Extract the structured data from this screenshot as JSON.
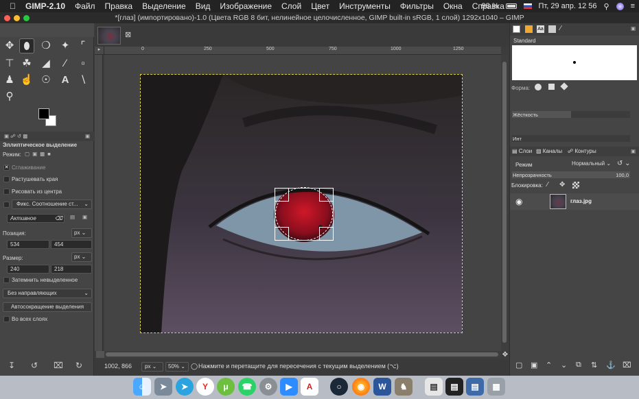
{
  "menubar": {
    "app": "GIMP-2.10",
    "items": [
      "Файл",
      "Правка",
      "Выделение",
      "Вид",
      "Изображение",
      "Слой",
      "Цвет",
      "Инструменты",
      "Фильтры",
      "Окна",
      "Справка"
    ],
    "battery": "98 %",
    "clock": "Пт, 29 апр.  12 56"
  },
  "window": {
    "title": "*[глаз] (импортировано)-1.0 (Цвета RGB 8 бит, нелинейное целочисленное, GIMP built-in sRGB, 1 слой) 1292x1040 – GIMP",
    "close_tab": "⊠"
  },
  "tool_options": {
    "title": "Эллиптическое выделение",
    "mode_label": "Режим:",
    "antialias": "Сглаживание",
    "feather": "Растушевать края",
    "from_center": "Рисовать из центра",
    "fixed": "Фикс. Соотношение ст...",
    "active": "Активное",
    "position_label": "Позиция:",
    "position_unit": "px",
    "position_x": "534",
    "position_y": "454",
    "size_label": "Размер:",
    "size_unit": "px",
    "size_w": "240",
    "size_h": "218",
    "dim_unselected": "Затемнить невыделенное",
    "guides": "Без направляющих",
    "autoshrink": "Автосокращение выделения",
    "all_layers": "Во всех слоях"
  },
  "ruler": {
    "top_ticks": [
      "0",
      "250",
      "500",
      "750",
      "1000",
      "1250"
    ]
  },
  "status": {
    "coords": "1002, 866",
    "unit": "px",
    "zoom": "50%",
    "hint": "Нажмите и перетащите для пересечения с текущим выделением (⌥)"
  },
  "brushes": {
    "name": "Standard",
    "shape_label": "Форма:",
    "hardness_label": "Жёсткость",
    "interval_label": "Инт"
  },
  "layers": {
    "tabs": [
      "Слои",
      "Каналы",
      "Контуры"
    ],
    "mode_label": "Режим",
    "mode_value": "Нормальный",
    "opacity_label": "Непрозрачность",
    "opacity_value": "100,0",
    "lock_label": "Блокировка:",
    "layer_name": "глаз.jpg"
  },
  "colors": {
    "menubar_bg": "#232323",
    "panel_bg": "#454545",
    "selection_dash": "#e0d34a"
  }
}
